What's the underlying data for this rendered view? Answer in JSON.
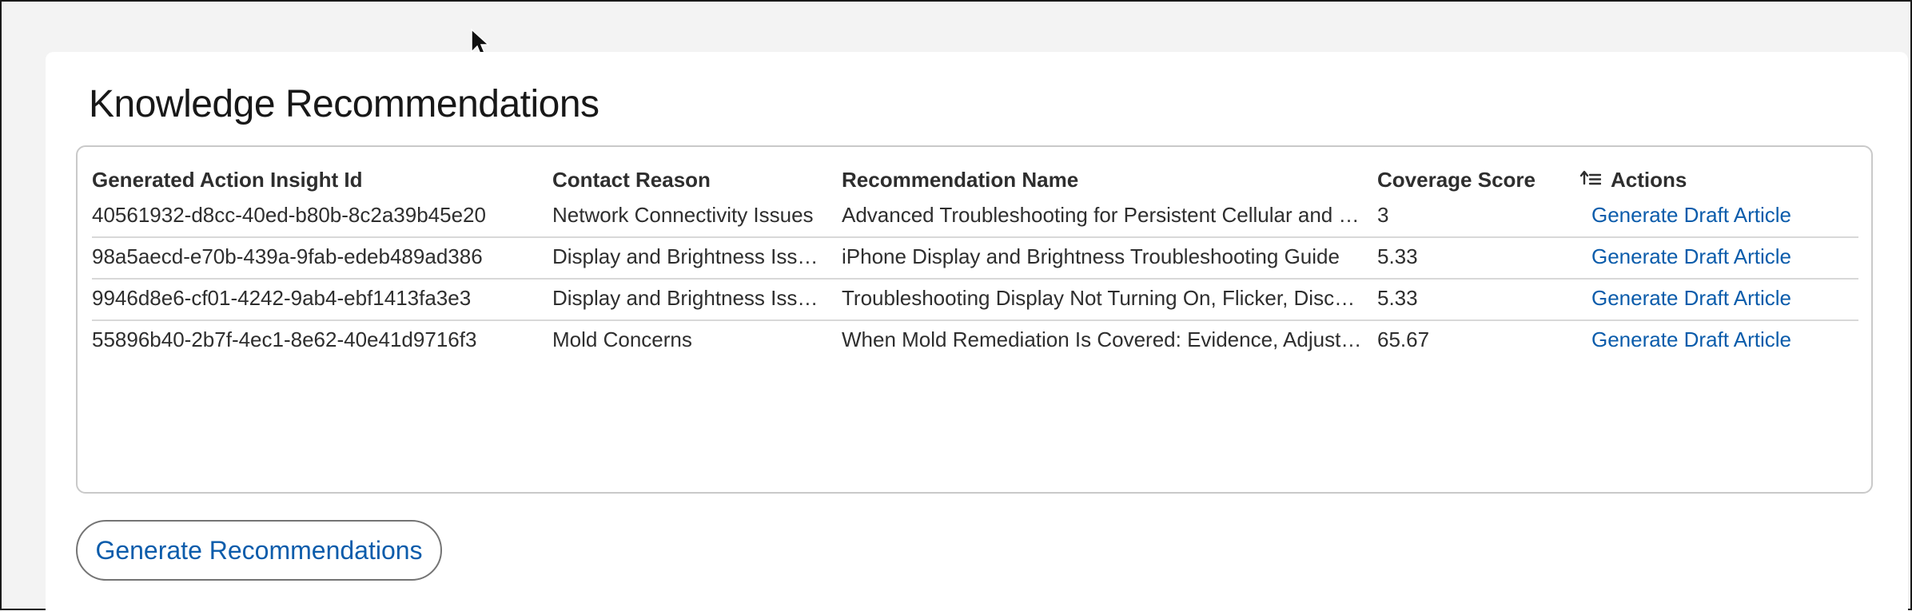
{
  "card": {
    "title": "Knowledge Recommendations"
  },
  "table": {
    "columns": [
      "Generated Action Insight Id",
      "Contact Reason",
      "Recommendation Name",
      "Coverage Score",
      "Actions"
    ],
    "sort_icon": "sort-ascending-icon",
    "rows": [
      {
        "id": "40561932-d8cc-40ed-b80b-8c2a39b45e20",
        "reason": "Network Connectivity Issues",
        "name": "Advanced Troubleshooting for Persistent Cellular and Wi-Fi Connectivity",
        "score": "3",
        "action": "Generate Draft Article"
      },
      {
        "id": "98a5aecd-e70b-439a-9fab-edeb489ad386",
        "reason": "Display and Brightness Issues",
        "name": "iPhone Display and Brightness Troubleshooting Guide",
        "score": "5.33",
        "action": "Generate Draft Article"
      },
      {
        "id": "9946d8e6-cf01-4242-9ab4-ebf1413fa3e3",
        "reason": "Display and Brightness Issues",
        "name": "Troubleshooting Display Not Turning On, Flicker, Discoloration",
        "score": "5.33",
        "action": "Generate Draft Article"
      },
      {
        "id": "55896b40-2b7f-4ec1-8e62-40e41d9716f3",
        "reason": "Mold Concerns",
        "name": "When Mold Remediation Is Covered: Evidence, Adjuster Review",
        "score": "65.67",
        "action": "Generate Draft Article"
      }
    ]
  },
  "footer": {
    "generate_label": "Generate Recommendations"
  },
  "colors": {
    "link": "#0b5cab",
    "text": "#2e2e2e",
    "background": "#f3f3f3",
    "card": "#ffffff"
  }
}
